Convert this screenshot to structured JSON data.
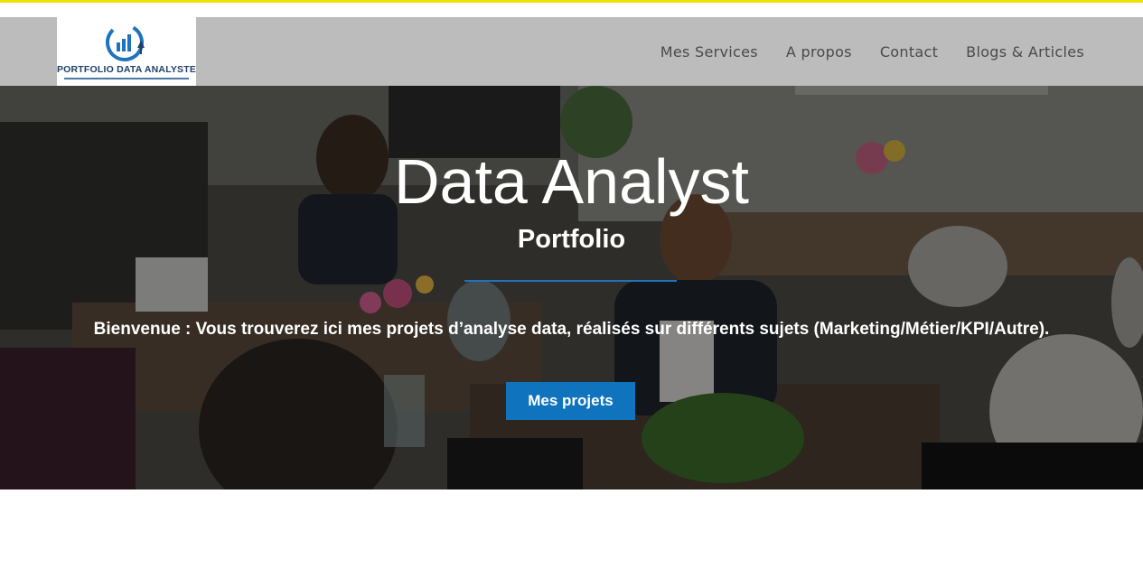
{
  "header": {
    "logo_text": "PORTFOLIO DATA ANALYSTE",
    "logo_icon": "bar-chart-growth-icon",
    "nav": [
      {
        "label": "Mes Services"
      },
      {
        "label": "A propos"
      },
      {
        "label": "Contact"
      },
      {
        "label": "Blogs & Articles"
      }
    ]
  },
  "hero": {
    "title": "Data Analyst",
    "subtitle": "Portfolio",
    "welcome": "Bienvenue : Vous trouverez ici mes projets d’analyse data, réalisés sur différents sujets (Marketing/Métier/KPI/Autre).",
    "button_label": "Mes projets"
  },
  "colors": {
    "accent": "#0f74bd",
    "header_bg": "#bcbcbc",
    "top_line": "#f0e000",
    "logo_text": "#1f3f6b"
  }
}
